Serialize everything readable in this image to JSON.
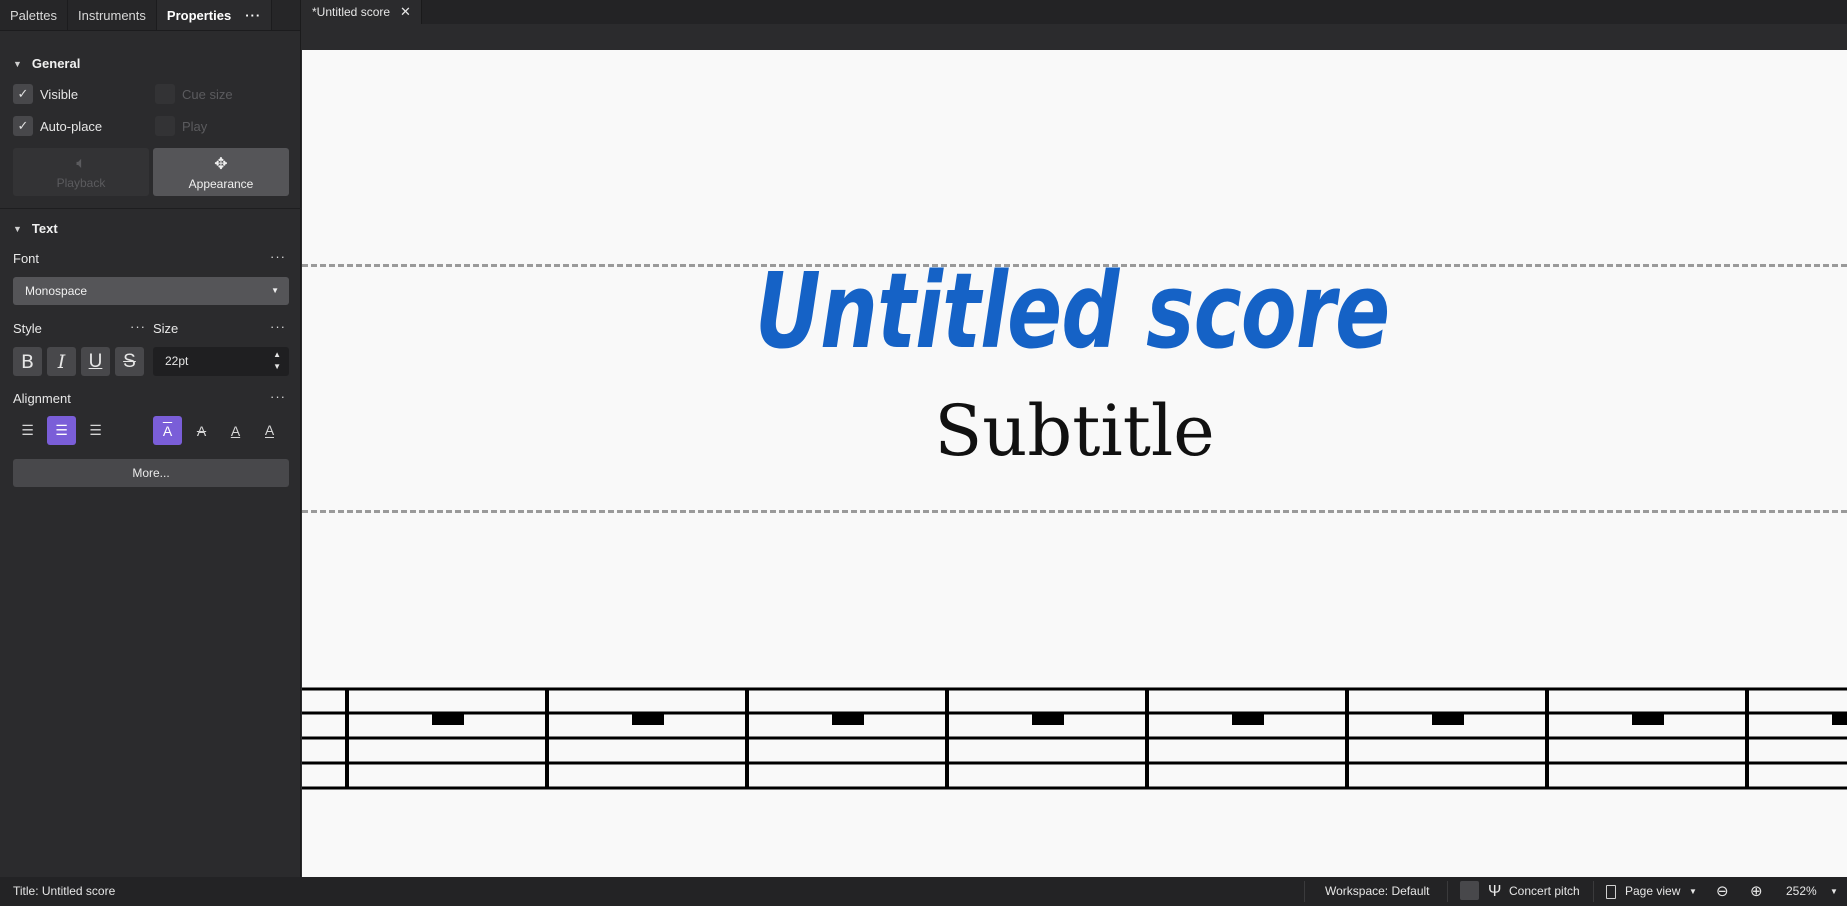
{
  "panel_tabs": [
    "Palettes",
    "Instruments",
    "Properties"
  ],
  "panel_tabs_more": "···",
  "general": {
    "header": "General",
    "visible_label": "Visible",
    "cue_size_label": "Cue size",
    "auto_place_label": "Auto-place",
    "play_label": "Play",
    "playback_label": "Playback",
    "appearance_label": "Appearance"
  },
  "text_section": {
    "header": "Text",
    "font_label": "Font",
    "font_value": "Monospace",
    "style_label": "Style",
    "size_label": "Size",
    "size_value": "22pt",
    "bold": "B",
    "italic": "I",
    "underline": "U",
    "strike": "S",
    "alignment_label": "Alignment",
    "more_label": "More..."
  },
  "dots": "···",
  "document_tab": {
    "label": "*Untitled score",
    "close": "✕"
  },
  "score": {
    "title": "Untitled score",
    "subtitle": "Subtitle"
  },
  "statusbar": {
    "title_info": "Title: Untitled score",
    "workspace": "Workspace: Default",
    "concert_pitch": "Concert pitch",
    "view_mode": "Page view",
    "zoom": "252%"
  },
  "colors": {
    "accent": "#7a5ed8",
    "title_text": "#1562c6",
    "panel_bg": "#2b2b2d",
    "score_bg": "#f9f9f9"
  }
}
